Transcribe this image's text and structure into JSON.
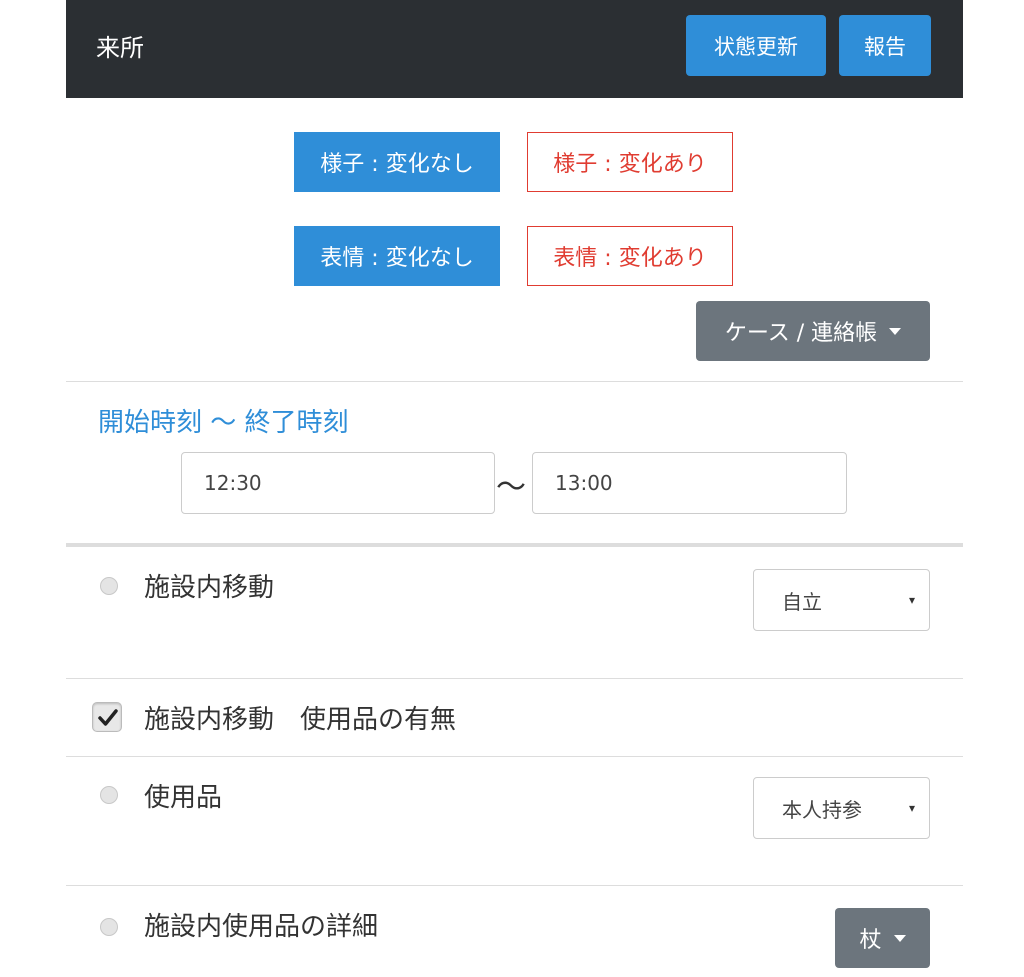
{
  "header": {
    "title": "来所",
    "update_button": "状態更新",
    "report_button": "報告"
  },
  "condition": {
    "appearance_no_change": "様子 : 変化なし",
    "appearance_changed": "様子 : 変化あり",
    "expression_no_change": "表情 : 変化なし",
    "expression_changed": "表情 : 変化あり",
    "selected_color": "#2f8ed8",
    "alert_color": "#e03c31"
  },
  "case_dropdown": {
    "label": "ケース / 連絡帳"
  },
  "time": {
    "section_title": "開始時刻 ～ 終了時刻",
    "start_value": "12:30",
    "separator": "～",
    "end_value": "13:00"
  },
  "items": [
    {
      "label": "施設内移動",
      "control": "select",
      "value": "自立"
    },
    {
      "label": "施設内移動　使用品の有無",
      "control": "checkbox",
      "checked": true
    },
    {
      "label": "使用品",
      "control": "select",
      "value": "本人持参"
    },
    {
      "label": "施設内使用品の詳細",
      "control": "dropdown",
      "value": "杖"
    }
  ],
  "icons": {
    "select_arrow": "▾"
  }
}
